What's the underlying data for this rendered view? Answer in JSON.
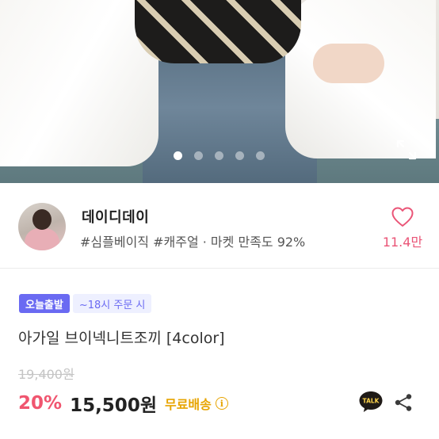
{
  "gallery": {
    "dot_count": 5,
    "active_index": 0
  },
  "shop": {
    "name": "데이디데이",
    "tags": "#심플베이직 #캐주얼 · 마켓 만족도 92%",
    "like_count": "11.4만"
  },
  "product": {
    "badge_today": "오늘출발",
    "badge_cutoff": "~18시 주문 시",
    "title": "아가일 브이넥니트조끼 [4color]",
    "original_price": "19,400원",
    "discount": "20%",
    "price": "15,500원",
    "shipping": "무료배송",
    "talk_label": "TALK"
  },
  "colors": {
    "accent_pink": "#f0556f",
    "heart_pink": "#ea5577",
    "badge_purple": "#6a6af2",
    "shipping_gold": "#e7a400"
  }
}
